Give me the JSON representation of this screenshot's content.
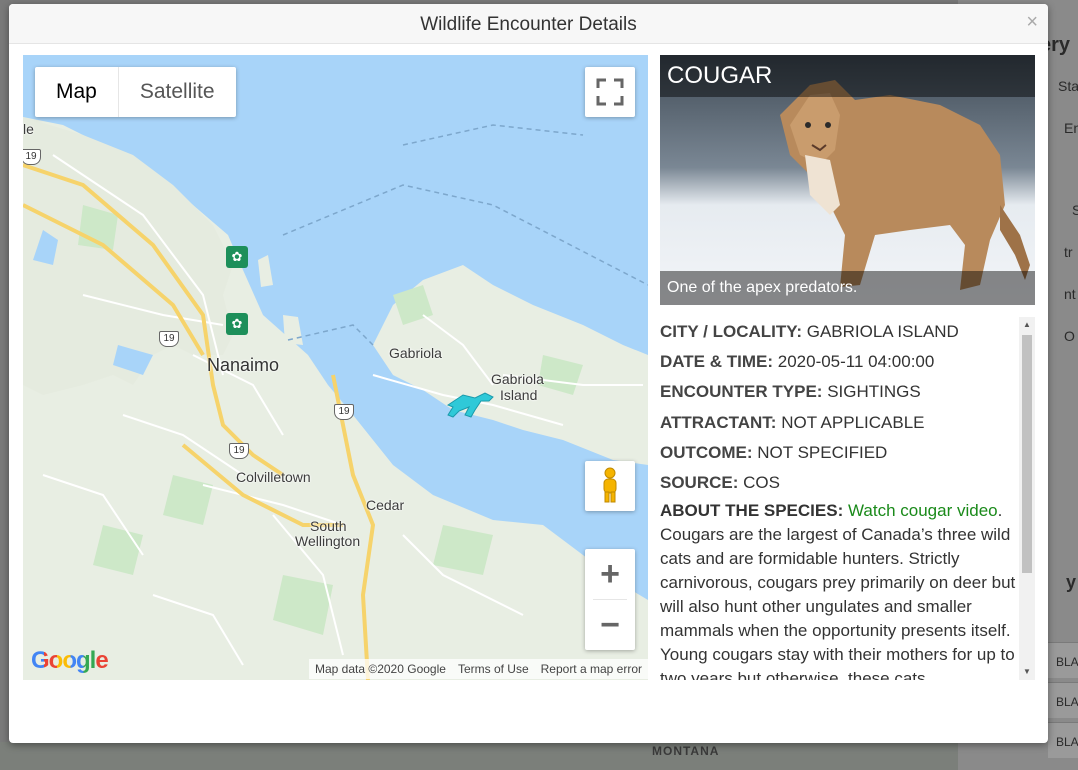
{
  "background": {
    "map_label": "MONTANA",
    "right_fragments": [
      "ery",
      "Sta",
      "En",
      "S",
      "tr",
      "nt",
      "O",
      "y"
    ],
    "row_labels": [
      "BLA",
      "BLA",
      "BLA"
    ]
  },
  "modal": {
    "title": "Wildlife Encounter Details",
    "close_label": "×"
  },
  "map": {
    "type_tabs": [
      {
        "label": "Map",
        "active": true
      },
      {
        "label": "Satellite",
        "active": false
      }
    ],
    "places": {
      "nanaimo": "Nanaimo",
      "gabriola": "Gabriola",
      "gabriola_island_line1": "Gabriola",
      "gabriola_island_line2": "Island",
      "colvilletown": "Colvilletown",
      "cedar": "Cedar",
      "south_wellington_line1": "South",
      "south_wellington_line2": "Wellington",
      "edge_fragment": "le"
    },
    "highway_shields": [
      "19",
      "19",
      "19",
      "19"
    ],
    "logo": "Google",
    "attribution": {
      "data": "Map data ©2020 Google",
      "terms": "Terms of Use",
      "report": "Report a map error"
    },
    "zoom_in": "+",
    "zoom_out": "−",
    "colors": {
      "water": "#a8d4f9",
      "land": "#e8eee3",
      "park": "#cde8c8",
      "highway": "#f6d36b",
      "marker": "#2fc9d8"
    }
  },
  "species": {
    "name": "COUGAR",
    "caption": "One of the apex predators."
  },
  "details": {
    "city_label": "CITY / LOCALITY:",
    "city_value": "GABRIOLA ISLAND",
    "datetime_label": "DATE & TIME:",
    "datetime_value": "2020-05-11 04:00:00",
    "type_label": "ENCOUNTER TYPE:",
    "type_value": "SIGHTINGS",
    "attractant_label": "ATTRACTANT:",
    "attractant_value": "NOT APPLICABLE",
    "outcome_label": "OUTCOME:",
    "outcome_value": "NOT SPECIFIED",
    "source_label": "SOURCE:",
    "source_value": "COS",
    "about_label": "ABOUT THE SPECIES:",
    "video_link": "Watch cougar video",
    "about_text": "Cougars are the largest of Canada’s three wild cats and are formidable hunters. Strictly carnivorous, cougars prey primarily on deer but will also hunt other ungulates and smaller mammals when the opportunity presents itself. Young cougars stay with their mothers for up to two years but otherwise, these cats"
  }
}
